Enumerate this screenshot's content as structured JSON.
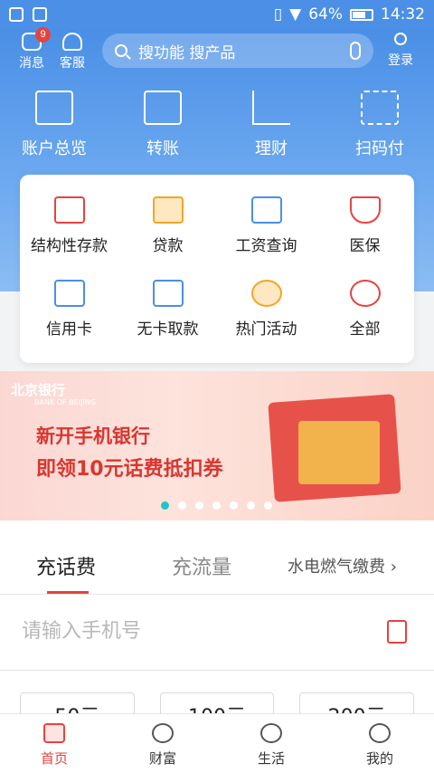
{
  "status_bar": {
    "battery": "64%",
    "time": "14:32"
  },
  "topbar": {
    "message_label": "消息",
    "message_badge": "9",
    "service_label": "客服",
    "login_label": "登录"
  },
  "search": {
    "placeholder": "搜功能 搜产品"
  },
  "main_functions": [
    {
      "label": "账户总览",
      "icon": "account-card-icon"
    },
    {
      "label": "转账",
      "icon": "transfer-icon"
    },
    {
      "label": "理财",
      "icon": "chart-icon"
    },
    {
      "label": "扫码付",
      "icon": "scan-icon"
    }
  ],
  "services": [
    {
      "label": "结构性存款",
      "icon": "structured-deposit-icon"
    },
    {
      "label": "贷款",
      "icon": "loan-icon"
    },
    {
      "label": "工资查询",
      "icon": "salary-icon"
    },
    {
      "label": "医保",
      "icon": "shield-icon"
    },
    {
      "label": "信用卡",
      "icon": "credit-card-icon"
    },
    {
      "label": "无卡取款",
      "icon": "cardless-withdraw-icon"
    },
    {
      "label": "热门活动",
      "icon": "star-icon"
    },
    {
      "label": "全部",
      "icon": "more-icon"
    }
  ],
  "banner": {
    "bank_name": "北京银行",
    "bank_english": "BANK OF BEIJING",
    "line1": "新开手机银行",
    "line2": "即领10元话费抵扣券",
    "slide_count": 7,
    "active_slide": 1
  },
  "recharge": {
    "tabs": [
      "充话费",
      "充流量",
      "水电燃气缴费"
    ],
    "active_tab": "充话费",
    "phone_placeholder": "请输入手机号",
    "amounts": [
      "50元",
      "100元",
      "200元"
    ]
  },
  "bottom_nav": [
    {
      "label": "首页",
      "active": true
    },
    {
      "label": "财富",
      "active": false
    },
    {
      "label": "生活",
      "active": false
    },
    {
      "label": "我的",
      "active": false
    }
  ],
  "colors": {
    "primary_blue": "#4a8fe6",
    "accent_red": "#e64340",
    "active_dot": "#25c3c8"
  }
}
